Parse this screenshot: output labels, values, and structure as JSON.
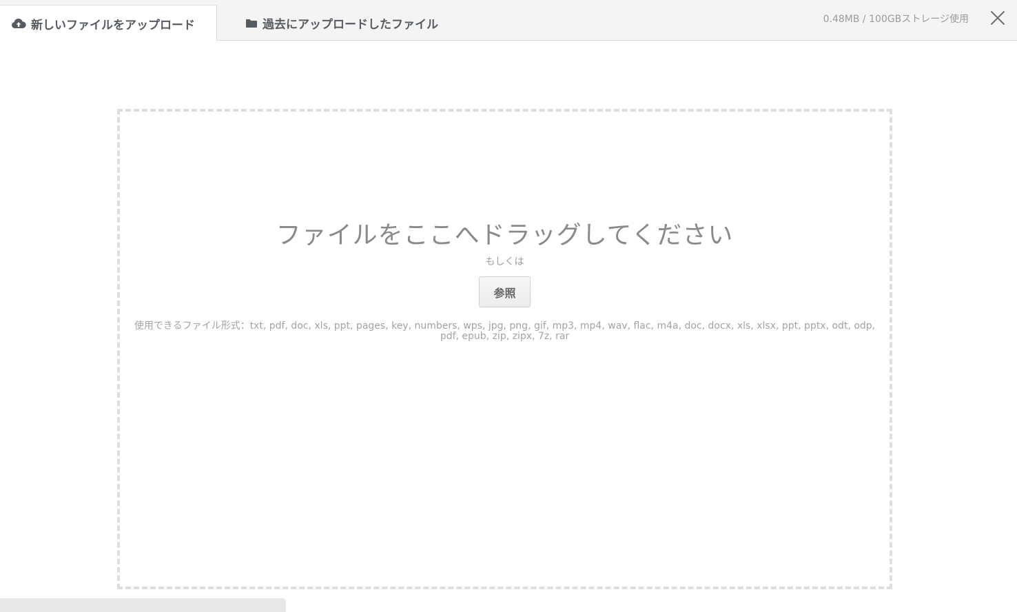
{
  "tabs": [
    {
      "label": "新しいファイルをアップロード",
      "icon": "cloud-upload-icon",
      "active": true
    },
    {
      "label": "過去にアップロードしたファイル",
      "icon": "folder-icon",
      "active": false
    }
  ],
  "storage": {
    "text": "0.48MB / 100GBストレージ使用"
  },
  "close": {
    "icon": "close-icon"
  },
  "dropzone": {
    "title": "ファイルをここへドラッグしてください",
    "or_text": "もしくは",
    "browse_label": "参照",
    "formats_text": "使用できるファイル形式：txt, pdf, doc, xls, ppt, pages, key, numbers, wps, jpg, png, gif, mp3, mp4, wav, flac, m4a, doc, docx, xls, xlsx, ppt, pptx, odt, odp, pdf, epub, zip, zipx, 7z, rar"
  },
  "colors": {
    "tab_bar": "#f4f4f4",
    "active_tab": "#ffffff",
    "dropzone_border": "#dedede",
    "text_muted": "#9a9a9a"
  }
}
